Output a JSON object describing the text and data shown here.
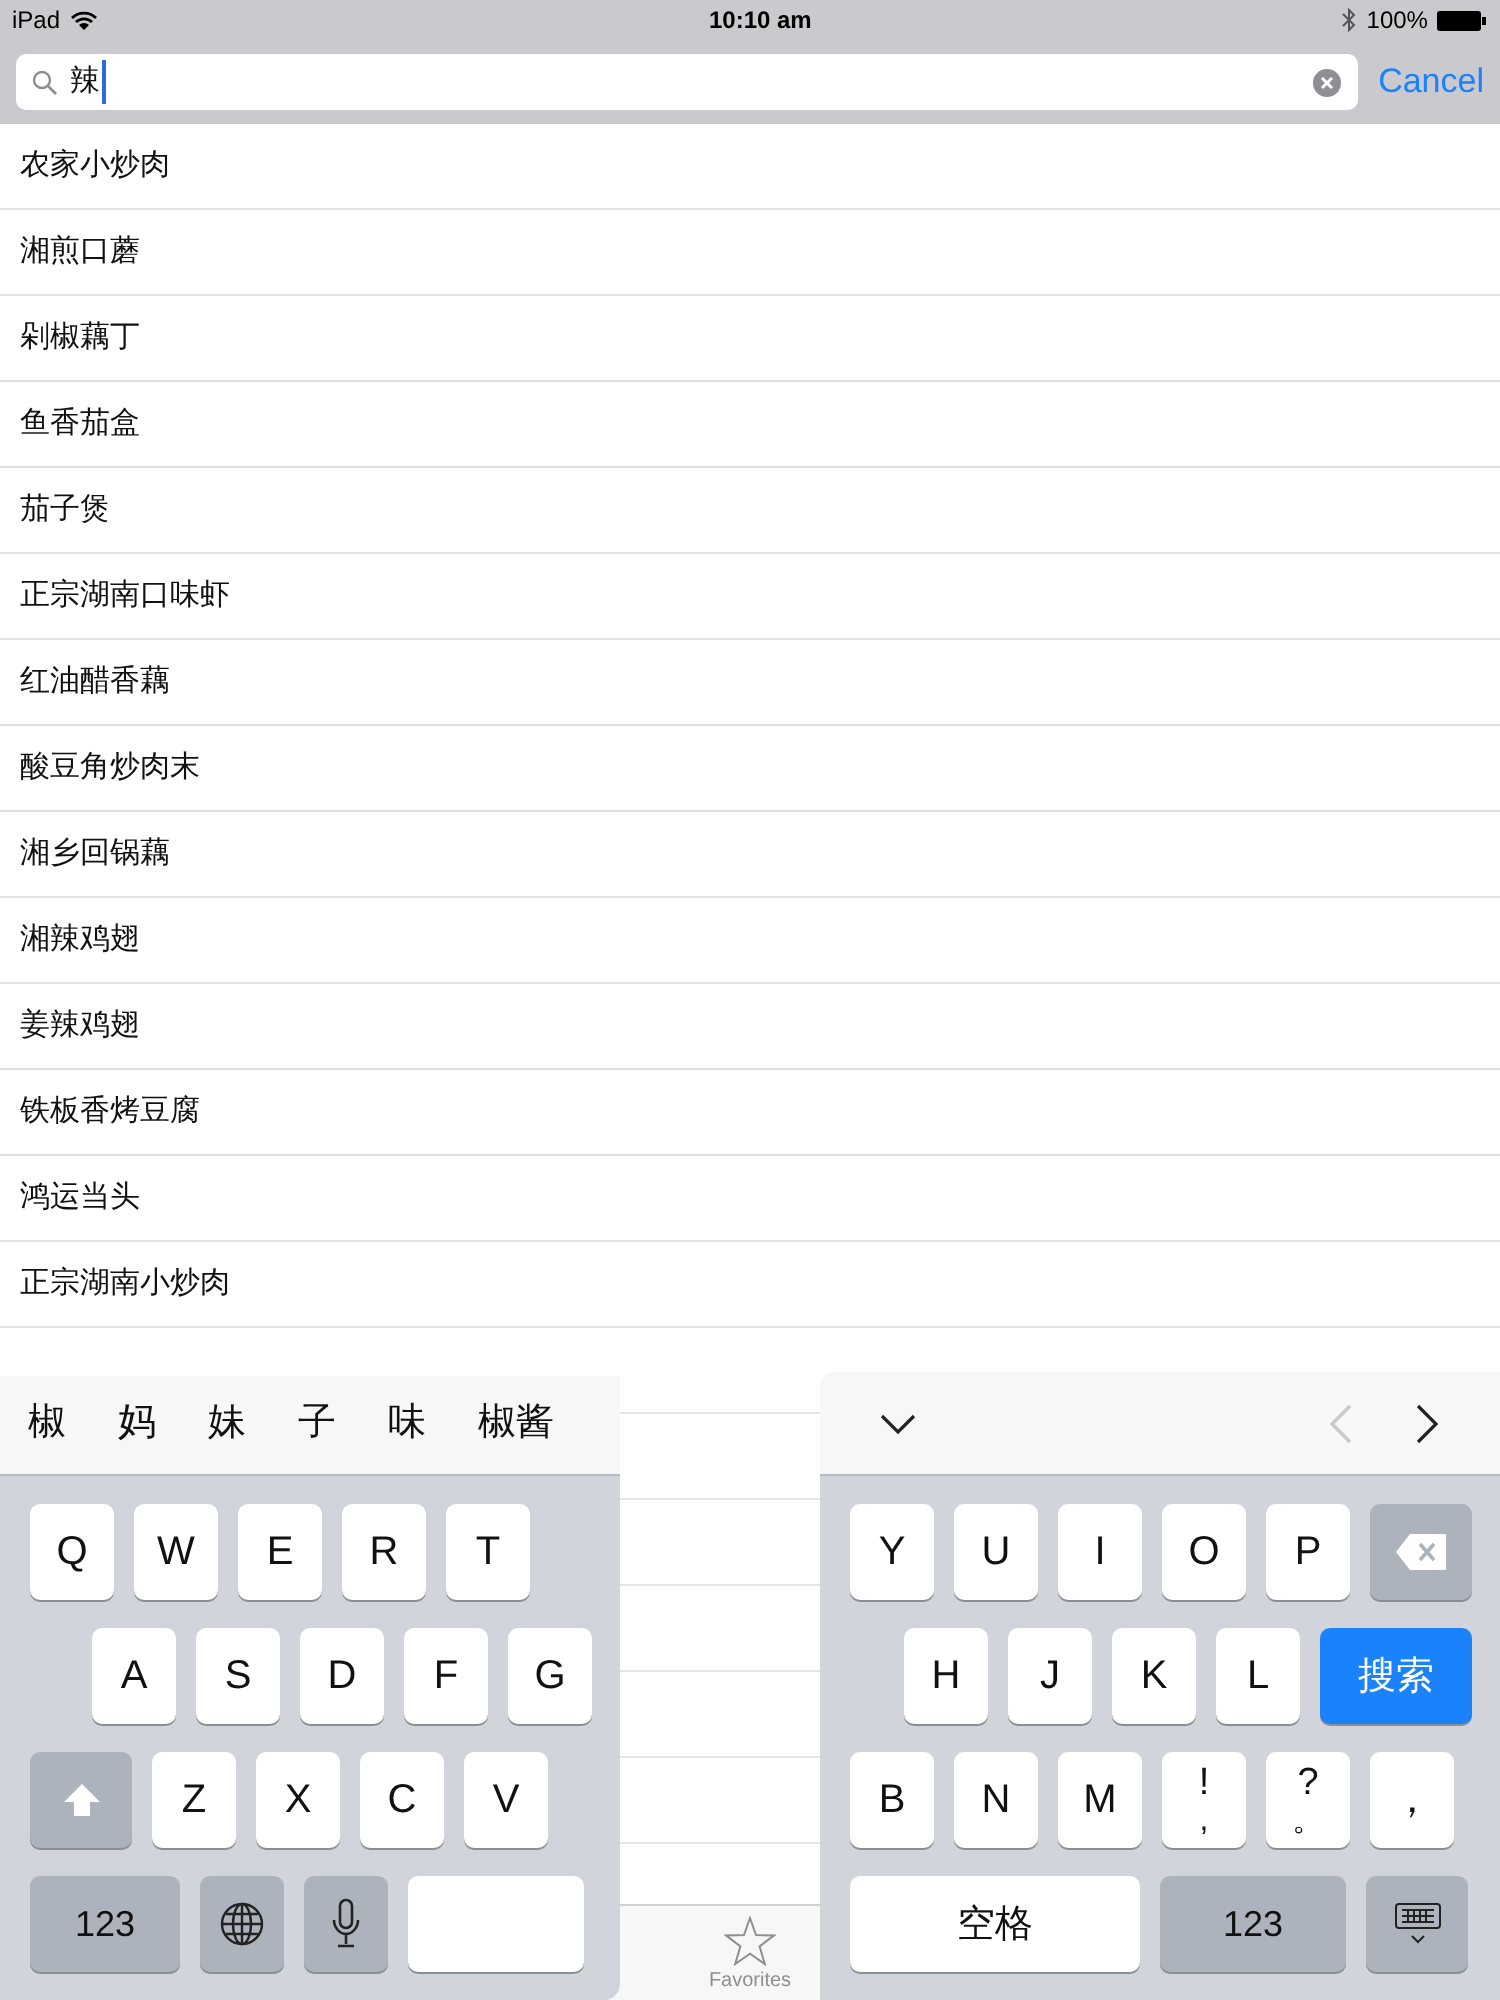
{
  "status_bar": {
    "device": "iPad",
    "time": "10:10 am",
    "battery": "100%"
  },
  "search": {
    "value": "辣",
    "action": "Cancel"
  },
  "results": [
    "农家小炒肉",
    "湘煎口蘑",
    "剁椒藕丁",
    "鱼香茄盒",
    "茄子煲",
    "正宗湖南口味虾",
    "红油醋香藕",
    "酸豆角炒肉末",
    "湘乡回锅藕",
    "湘辣鸡翅",
    "姜辣鸡翅",
    "铁板香烤豆腐",
    "鸿运当头",
    "正宗湖南小炒肉"
  ],
  "candidates": [
    "椒",
    "妈",
    "妹",
    "子",
    "味",
    "椒酱"
  ],
  "accessory_bar": [
    {
      "kind": "hide"
    },
    {
      "kind": "previous",
      "disabled": true
    },
    {
      "kind": "next",
      "disabled": false
    }
  ],
  "keyboard_left": [
    [
      {
        "kind": "letter",
        "label": "Q"
      },
      {
        "kind": "letter",
        "label": "W"
      },
      {
        "kind": "letter",
        "label": "E"
      },
      {
        "kind": "letter",
        "label": "R"
      },
      {
        "kind": "letter",
        "label": "T"
      }
    ],
    [
      {
        "kind": "letter",
        "label": "A"
      },
      {
        "kind": "letter",
        "label": "S"
      },
      {
        "kind": "letter",
        "label": "D"
      },
      {
        "kind": "letter",
        "label": "F"
      },
      {
        "kind": "letter",
        "label": "G"
      }
    ],
    [
      {
        "kind": "shift"
      },
      {
        "kind": "letter",
        "label": "Z"
      },
      {
        "kind": "letter",
        "label": "X"
      },
      {
        "kind": "letter",
        "label": "C"
      },
      {
        "kind": "letter",
        "label": "V"
      }
    ],
    [
      {
        "kind": "numbers",
        "label": "123"
      },
      {
        "kind": "globe"
      },
      {
        "kind": "mic"
      },
      {
        "kind": "space"
      }
    ]
  ],
  "keyboard_right": [
    [
      {
        "kind": "letter",
        "label": "Y"
      },
      {
        "kind": "letter",
        "label": "U"
      },
      {
        "kind": "letter",
        "label": "I"
      },
      {
        "kind": "letter",
        "label": "O"
      },
      {
        "kind": "letter",
        "label": "P"
      },
      {
        "kind": "delete"
      }
    ],
    [
      {
        "kind": "letter",
        "label": "H"
      },
      {
        "kind": "letter",
        "label": "J"
      },
      {
        "kind": "letter",
        "label": "K"
      },
      {
        "kind": "letter",
        "label": "L"
      },
      {
        "kind": "return",
        "label": "搜索"
      }
    ],
    [
      {
        "kind": "letter",
        "label": "B"
      },
      {
        "kind": "letter",
        "label": "N"
      },
      {
        "kind": "letter",
        "label": "M"
      },
      {
        "kind": "punct",
        "label": "!",
        "sublabel": ","
      },
      {
        "kind": "punct",
        "label": "?",
        "sublabel": "。"
      },
      {
        "kind": "letter",
        "label": "，"
      }
    ],
    [
      {
        "kind": "space",
        "label": "空格"
      },
      {
        "kind": "numbers",
        "label": "123"
      },
      {
        "kind": "hide_keyboard"
      }
    ]
  ],
  "tab_bar": [
    {
      "label": "Favorites",
      "selected": false
    }
  ]
}
